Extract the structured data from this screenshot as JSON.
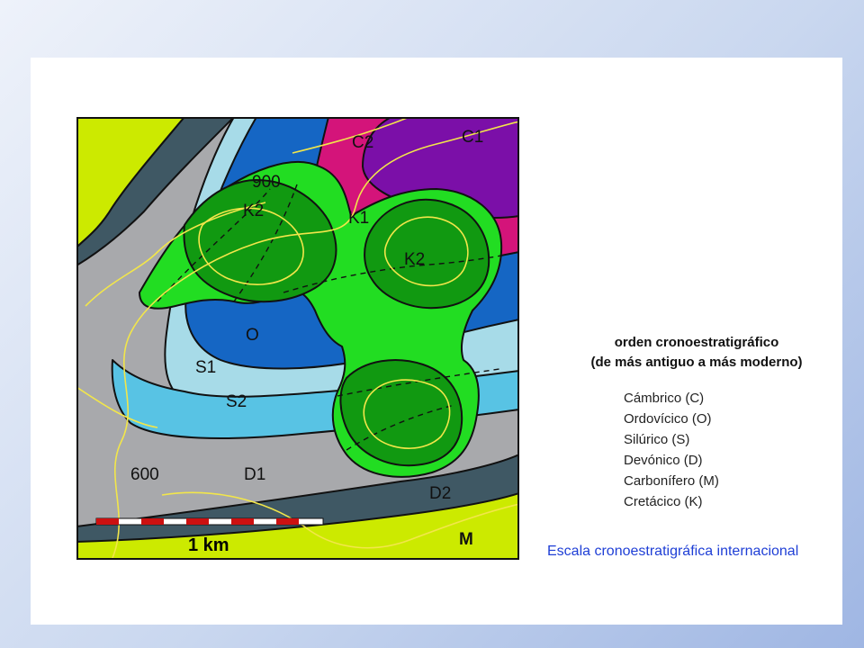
{
  "map": {
    "labels": {
      "c1": "C1",
      "c2": "C2",
      "k1": "K1",
      "k2a": "K2",
      "k2b": "K2",
      "o": "O",
      "s1": "S1",
      "s2": "S2",
      "d1": "D1",
      "d2": "D2",
      "m": "M",
      "contour_900": "900",
      "contour_600": "600"
    },
    "scale_bar": "1 km",
    "colors": {
      "cambrian": "#7b0fa8",
      "carboniferous_top": "#d4147a",
      "cretaceous_light": "#22dd22",
      "cretaceous_dark": "#119911",
      "ordovician": "#1566c4",
      "silurian_1": "#a7dbe8",
      "silurian_2": "#58c3e4",
      "devonian": "#a8a9ac",
      "devonian_dark": "#3f5864",
      "miocene": "#ccea00",
      "contour": "#f2e64a"
    }
  },
  "legend": {
    "title_line1": "orden cronoestratigráfico",
    "title_line2": "(de más antiguo a más moderno)",
    "items": [
      "Cámbrico (C)",
      "Ordovícico (O)",
      "Silúrico (S)",
      "Devónico (D)",
      "Carbonífero (M)",
      "Cretácico (K)"
    ]
  },
  "caption": "Escala cronoestratigráfica internacional"
}
